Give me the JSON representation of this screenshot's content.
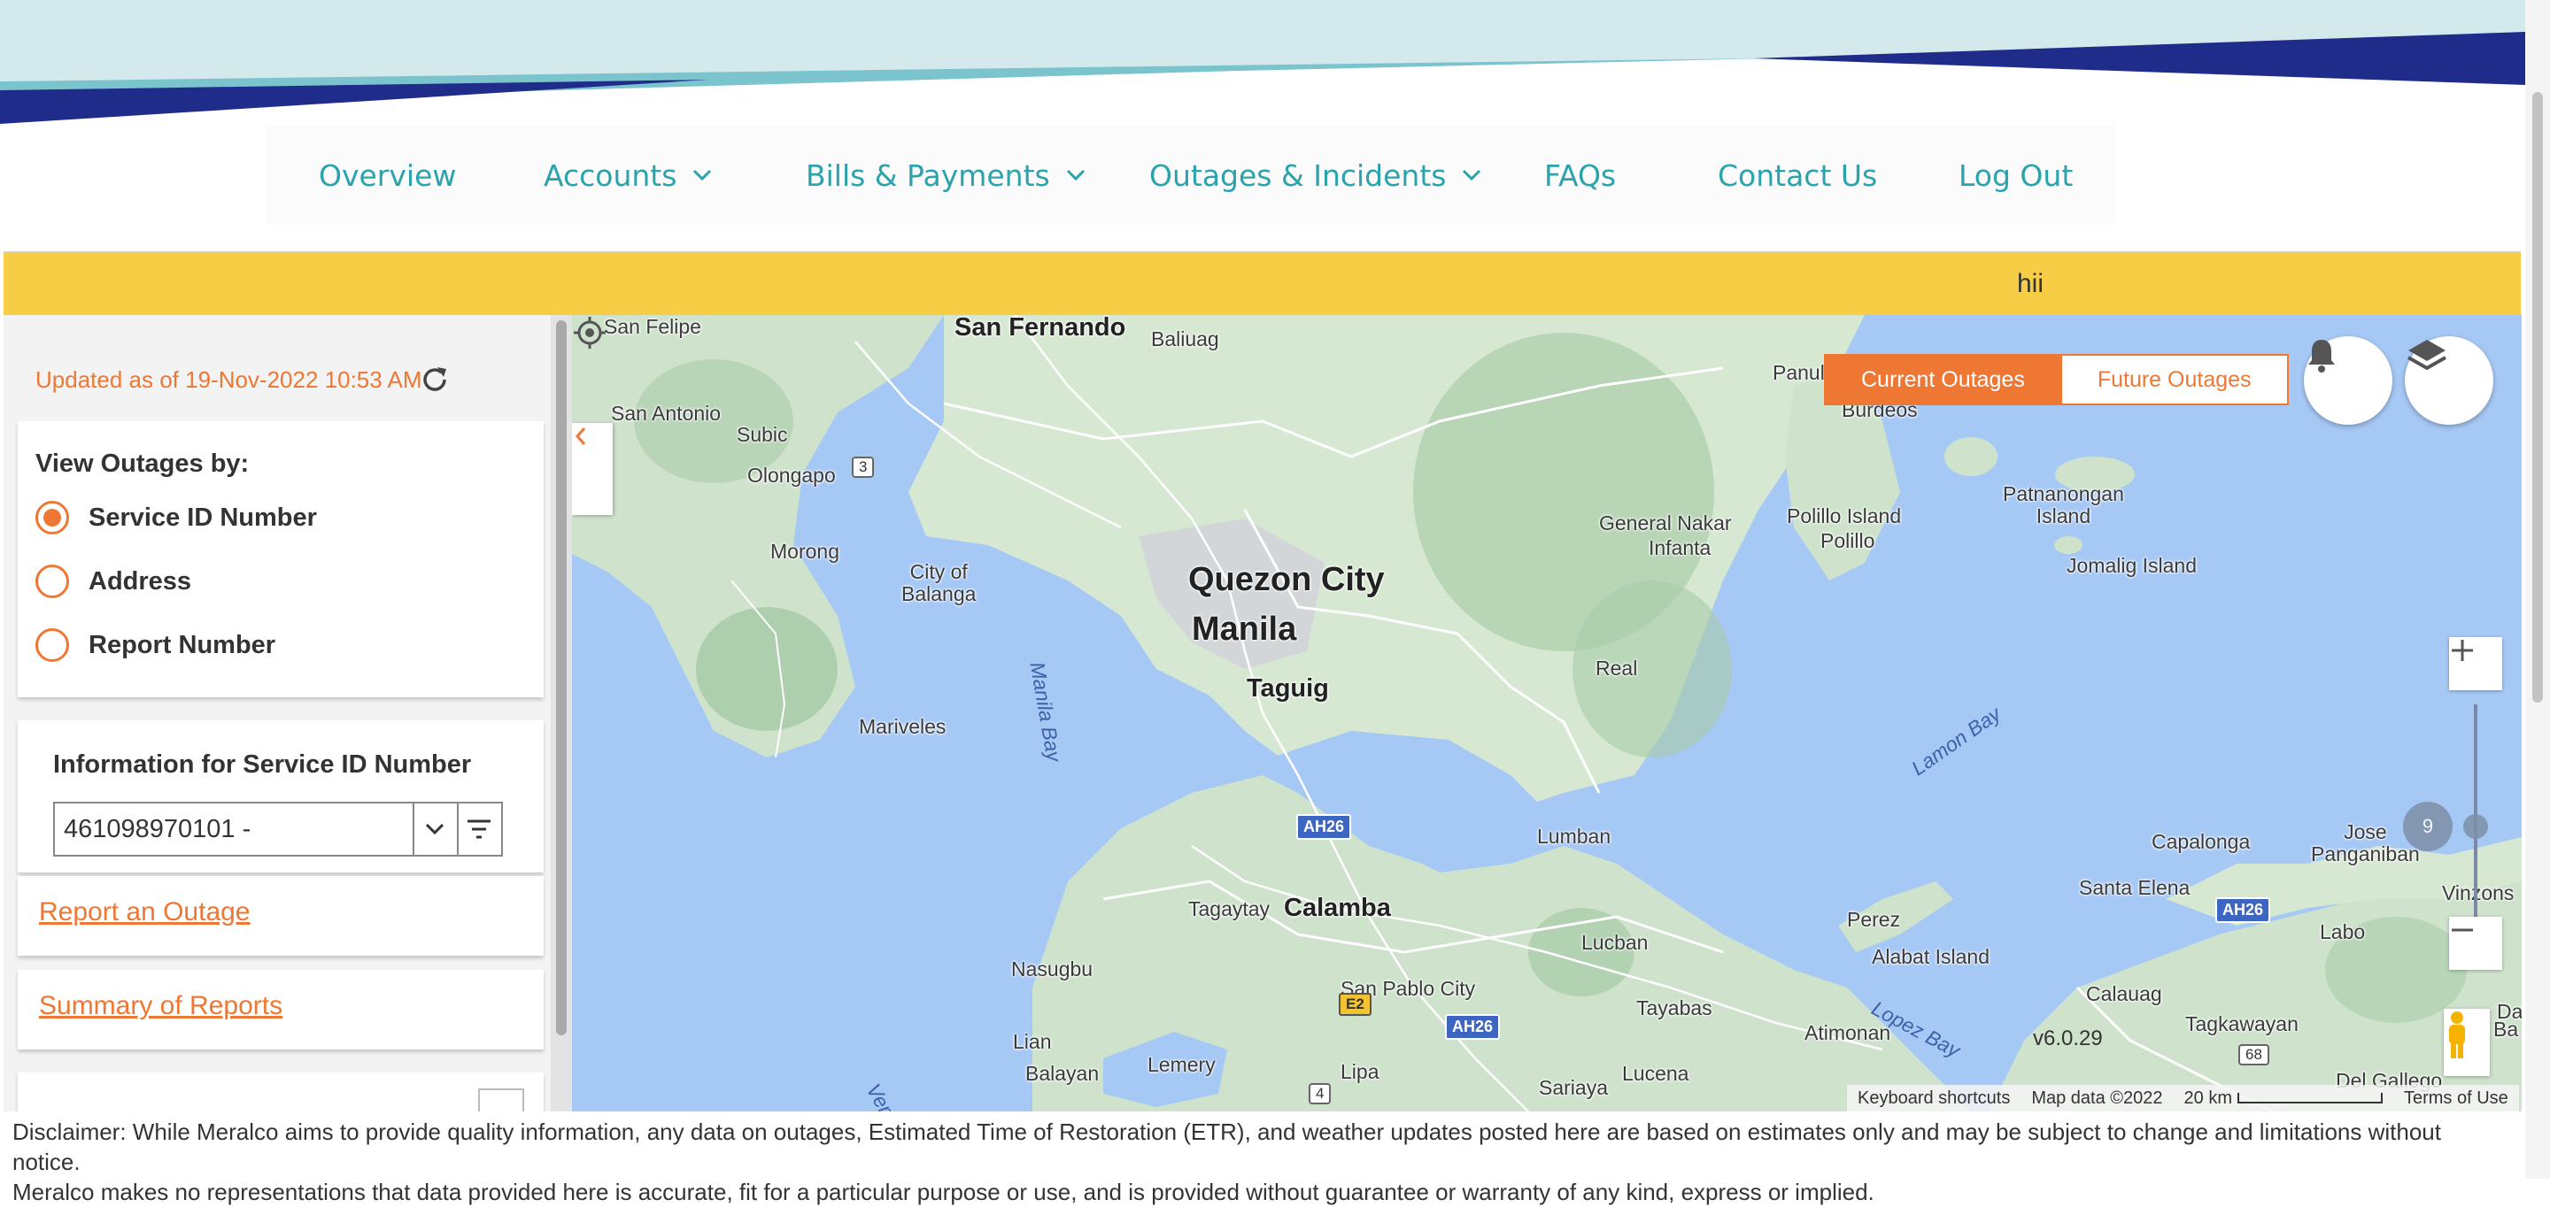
{
  "nav": {
    "items": [
      {
        "label": "Overview",
        "dropdown": false
      },
      {
        "label": "Accounts",
        "dropdown": true
      },
      {
        "label": "Bills & Payments",
        "dropdown": true
      },
      {
        "label": "Outages & Incidents",
        "dropdown": true
      },
      {
        "label": "FAQs",
        "dropdown": false
      },
      {
        "label": "Contact Us",
        "dropdown": false
      },
      {
        "label": "Log Out",
        "dropdown": false
      }
    ]
  },
  "alert": {
    "text": "hii"
  },
  "panel": {
    "updated": "Updated as of 19-Nov-2022 10:53 AM",
    "view_title": "View Outages by:",
    "options": [
      {
        "label": "Service ID Number",
        "checked": true
      },
      {
        "label": "Address",
        "checked": false
      },
      {
        "label": "Report Number",
        "checked": false
      }
    ],
    "info_title": "Information for Service ID Number",
    "service_id_value": "461098970101 -",
    "report_link": "Report an Outage",
    "summary_link": "Summary of Reports"
  },
  "map": {
    "toggle": {
      "current": "Current Outages",
      "future": "Future Outages"
    },
    "zoom_level": "9",
    "version": "v6.0.29",
    "attribution": {
      "shortcuts": "Keyboard shortcuts",
      "data": "Map data ©2022",
      "scale": "20 km",
      "terms": "Terms of Use"
    },
    "places": {
      "quezon": "Quezon City",
      "manila": "Manila",
      "taguig": "Taguig",
      "calamba": "Calamba",
      "san_fernando": "San Fernando",
      "san_felipe": "San Felipe",
      "baliuag": "Baliuag",
      "san_antonio": "San Antonio",
      "subic": "Subic",
      "olongapo": "Olongapo",
      "morong": "Morong",
      "city_of_balanga": "City of\nBalanga",
      "mariveles": "Mariveles",
      "manila_bay": "Manila Bay",
      "general_nakar": "General Nakar",
      "infanta": "Infanta",
      "real": "Real",
      "lumban": "Lumban",
      "lamon_bay": "Lamon Bay",
      "panul": "Panul",
      "burdeos": "Burdeos",
      "polillo_island": "Polillo Island",
      "polillo": "Polillo",
      "patnanongan": "Patnanongan\nIsland",
      "jomalig": "Jomalig Island",
      "capalonga": "Capalonga",
      "jose_panganiban": "Jose\nPanganiban",
      "santa_elena": "Santa Elena",
      "vinzons": "Vinzons",
      "labo": "Labo",
      "perez": "Perez",
      "alabat": "Alabat Island",
      "calauag": "Calauag",
      "tagkawayan": "Tagkawayan",
      "lopez_bay": "Lopez Bay",
      "atimonan": "Atimonan",
      "tayabas": "Tayabas",
      "lucban": "Lucban",
      "lucena": "Lucena",
      "sariaya": "Sariaya",
      "san_pablo": "San Pablo City",
      "lipa": "Lipa",
      "lemery": "Lemery",
      "tagaytay": "Tagaytay",
      "nasugbu": "Nasugbu",
      "lian": "Lian",
      "balayan": "Balayan",
      "del_gallego": "Del Gallego",
      "da": "Da",
      "ba": "Ba",
      "ver": "Ver"
    },
    "shields": {
      "ah26a": "AH26",
      "ah26b": "AH26",
      "ah26c": "AH26",
      "e2": "E2",
      "r4": "4",
      "r3": "3",
      "r68": "68"
    }
  },
  "disclaimer": {
    "line1": "Disclaimer: While Meralco aims to provide quality information, any data on outages, Estimated Time of Restoration (ETR), and weather updates posted here are based on estimates only and may be subject to change and limitations without notice.",
    "line2": "Meralco makes no representations that data provided here is accurate, fit for a particular purpose or use, and is provided without guarantee or warranty of any kind, express or implied."
  },
  "colors": {
    "accent": "#ee7733",
    "nav_text": "#2aa3ad",
    "alert": "#f7cd45",
    "water": "#a6c8f5",
    "land": "#cfe3cc"
  }
}
